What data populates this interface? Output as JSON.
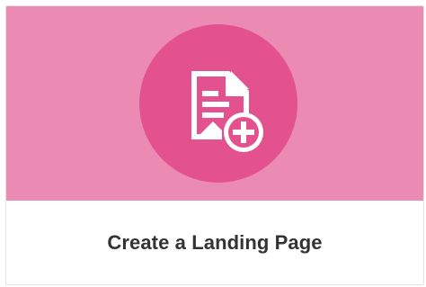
{
  "card": {
    "title": "Create a Landing Page",
    "icon": "page-add-icon"
  },
  "colors": {
    "banner": "#eb8ab2",
    "icon_circle": "#e3528f",
    "icon_glyph": "#ffffff",
    "title_text": "#333333"
  }
}
